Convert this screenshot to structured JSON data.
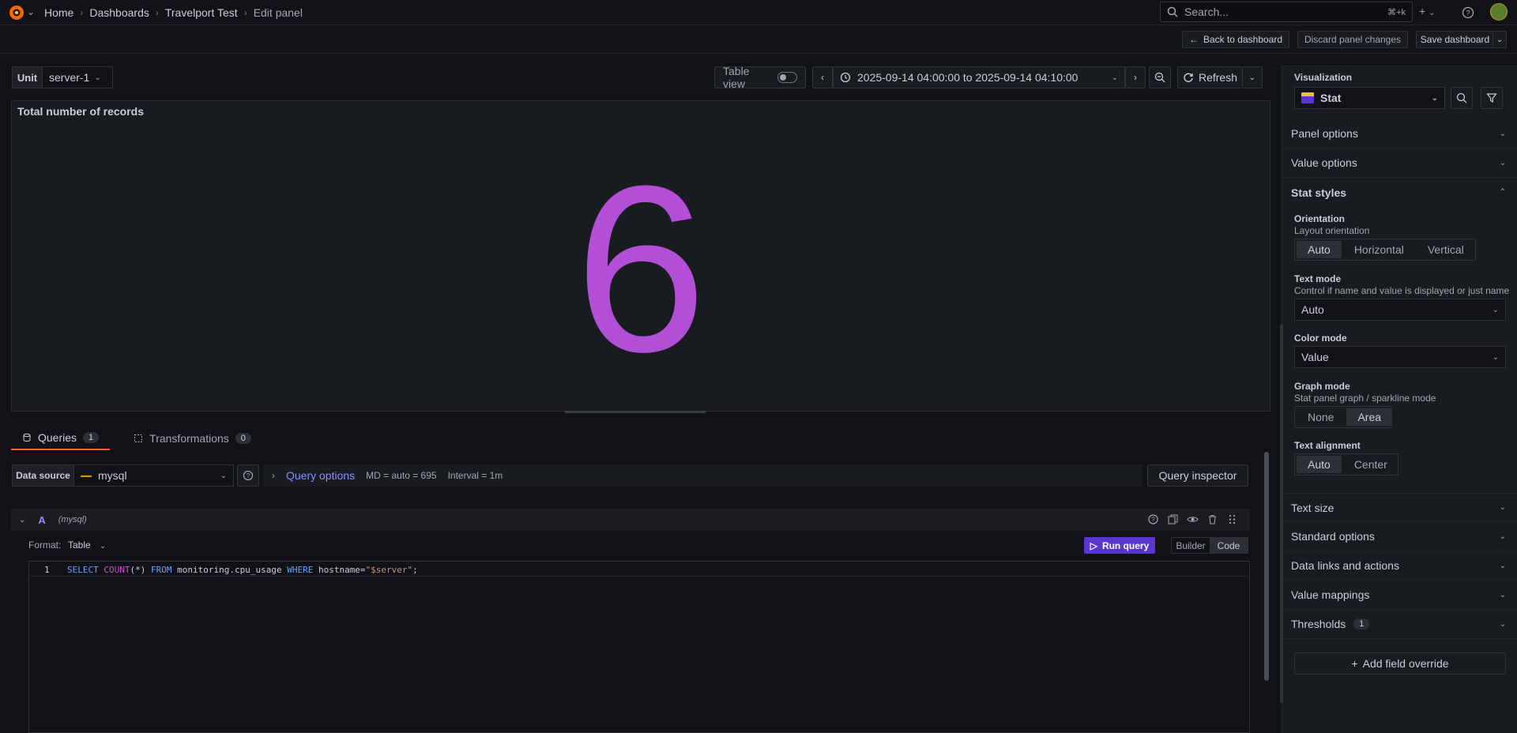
{
  "topbar": {
    "breadcrumb": [
      "Home",
      "Dashboards",
      "Travelport Test"
    ],
    "current": "Edit panel",
    "search_placeholder": "Search...",
    "search_shortcut": "⌘+k",
    "plus_label": "+"
  },
  "actions": {
    "back": "Back to dashboard",
    "discard": "Discard panel changes",
    "save": "Save dashboard"
  },
  "variables": {
    "unit_label": "Unit",
    "unit_value": "server-1"
  },
  "toolbar": {
    "table_view": "Table view",
    "time_range": "2025-09-14 04:00:00 to 2025-09-14 04:10:00",
    "refresh": "Refresh"
  },
  "panel": {
    "title": "Total number of records",
    "value": "6",
    "value_color": "#b24fd6"
  },
  "tabs": [
    {
      "label": "Queries",
      "count": "1"
    },
    {
      "label": "Transformations",
      "count": "0"
    }
  ],
  "query": {
    "ds_label": "Data source",
    "ds_value": "mysql",
    "query_options": "Query options",
    "md": "MD = auto = 695",
    "interval": "Interval = 1m",
    "inspector": "Query inspector",
    "ref_id": "A",
    "ref_ds": "(mysql)",
    "format_label": "Format:",
    "format_value": "Table",
    "run": "Run query",
    "builder": "Builder",
    "code": "Code",
    "line_number": "1",
    "sql": {
      "select": "SELECT",
      "count": "COUNT",
      "args": "(*)",
      "from": "FROM",
      "table": "monitoring.cpu_usage",
      "where": "WHERE",
      "col": "hostname=",
      "val": "\"$server\"",
      "end": ";"
    }
  },
  "sidebar": {
    "viz_label": "Visualization",
    "viz_value": "Stat",
    "sections_top": [
      "Panel options",
      "Value options"
    ],
    "stat_styles": "Stat styles",
    "orientation": {
      "title": "Orientation",
      "desc": "Layout orientation",
      "options": [
        "Auto",
        "Horizontal",
        "Vertical"
      ]
    },
    "text_mode": {
      "title": "Text mode",
      "desc": "Control if name and value is displayed or just name",
      "value": "Auto"
    },
    "color_mode": {
      "title": "Color mode",
      "value": "Value"
    },
    "graph_mode": {
      "title": "Graph mode",
      "desc": "Stat panel graph / sparkline mode",
      "options": [
        "None",
        "Area"
      ]
    },
    "text_alignment": {
      "title": "Text alignment",
      "options": [
        "Auto",
        "Center"
      ]
    },
    "sections_bottom": [
      "Text size",
      "Standard options",
      "Data links and actions",
      "Value mappings"
    ],
    "thresholds": "Thresholds",
    "thresholds_count": "1",
    "add_override": "Add field override"
  }
}
